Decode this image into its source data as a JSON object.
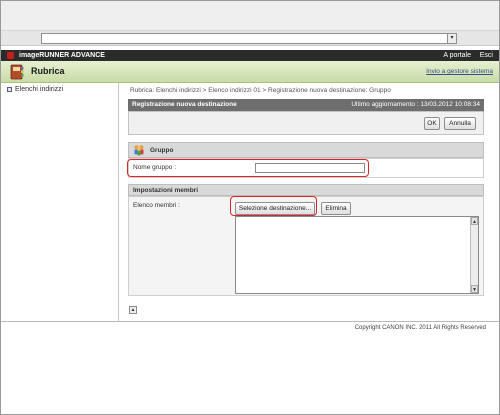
{
  "browser": {
    "dropdown_glyph": "▾"
  },
  "header": {
    "brand": "imageRUNNER ADVANCE",
    "portal_link": "A portale",
    "exit_link": "Esci"
  },
  "titlebar": {
    "title": "Rubrica",
    "back_link": "Invio a gestore sistema",
    "icon": "address-book-icon"
  },
  "sidebar": {
    "items": [
      {
        "label": "Elenchi indirizzi",
        "icon": "bullet-icon"
      }
    ]
  },
  "breadcrumb": "Rubrica: Elenchi indirizzi > Elenco indirizzi 01 > Registrazione nuova destinazione: Gruppo",
  "page": {
    "title": "Registrazione nuova destinazione",
    "last_update": "Ultimo aggiornamento : 13/03.2012 10:08:34",
    "ok_label": "OK",
    "cancel_label": "Annulla"
  },
  "group": {
    "heading": "Gruppo",
    "icon": "group-icon",
    "name_label": "Nome gruppo :",
    "name_value": ""
  },
  "members": {
    "heading": "Impostazioni membri",
    "list_label": "Elenco membri :",
    "select_label": "Selezione destinazione...",
    "delete_label": "Elimina",
    "items": []
  },
  "footer": {
    "copyright": "Copyright CANON INC. 2011 All Rights Reserved",
    "top_icon": "scroll-to-top-icon"
  },
  "colors": {
    "accent_red": "#d9262a",
    "appbar": "#2b2b2b",
    "title_green": "#c9dca6",
    "section_gray": "#6e6e6e"
  }
}
